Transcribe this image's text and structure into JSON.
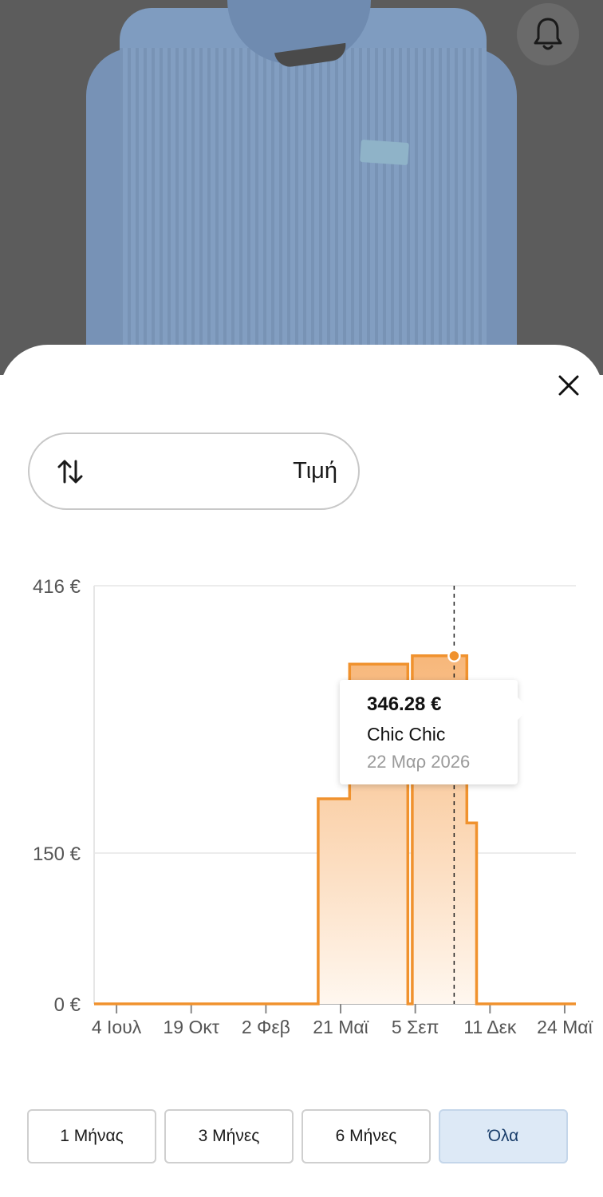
{
  "header": {
    "bell_icon": "bell-icon"
  },
  "sheet": {
    "close_icon": "close-icon"
  },
  "sort": {
    "icon": "sort-arrows-icon",
    "label": "Τιμή"
  },
  "colors": {
    "accent": "#f0922e",
    "fill_top": "#f7b77a",
    "fill_bottom": "#fff7ef",
    "active_range": "#dde9f6"
  },
  "chart_data": {
    "type": "area",
    "step": true,
    "title": "",
    "xlabel": "",
    "ylabel": "",
    "y_ticks": [
      "416 €",
      "150 €",
      "0 €"
    ],
    "y_tick_values": [
      416,
      150,
      0
    ],
    "ylim": [
      0,
      416
    ],
    "x_ticks": [
      "4 Ιουλ",
      "19 Οκτ",
      "2 Φεβ",
      "21 Μαϊ",
      "5 Σεπ",
      "11 Δεκ",
      "24 Μαϊ"
    ],
    "xlim": [
      0,
      6.45
    ],
    "grid": true,
    "series": [
      {
        "x": [
          0,
          3.0,
          3.0,
          3.42,
          3.42,
          4.2,
          4.2,
          4.26,
          4.26,
          4.99,
          4.99,
          5.12,
          5.12,
          5.15,
          5.15,
          6.45
        ],
        "y": [
          0,
          0,
          204,
          204,
          338,
          338,
          0,
          0,
          346.28,
          346.28,
          180,
          180,
          0,
          0,
          0,
          0
        ]
      }
    ],
    "annotation": {
      "x": 4.82,
      "y": 346.28,
      "price": "346.28 €",
      "store": "Chic Chic",
      "date": "22 Μαρ 2026"
    }
  },
  "ranges": [
    {
      "label": "1 Μήνας",
      "active": false
    },
    {
      "label": "3 Μήνες",
      "active": false
    },
    {
      "label": "6 Μήνες",
      "active": false
    },
    {
      "label": "Όλα",
      "active": true
    }
  ]
}
